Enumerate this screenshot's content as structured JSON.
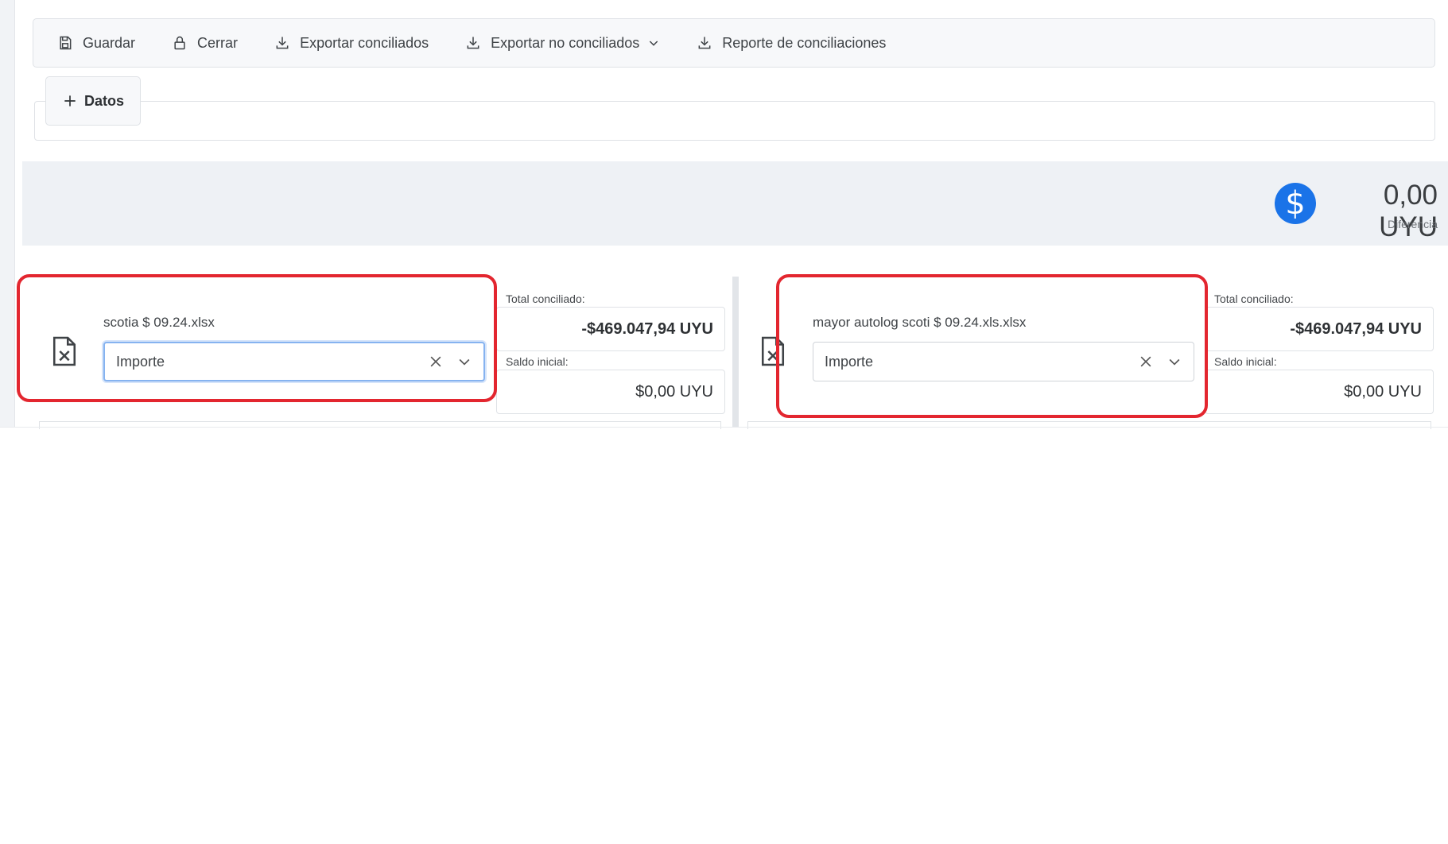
{
  "toolbar": {
    "buttons": [
      {
        "label": "Guardar",
        "icon": "save-icon"
      },
      {
        "label": "Cerrar",
        "icon": "lock-icon"
      },
      {
        "label": "Exportar conciliados",
        "icon": "download-icon"
      },
      {
        "label": "Exportar no conciliados",
        "icon": "download-icon",
        "dropdown": true
      },
      {
        "label": "Reporte de conciliaciones",
        "icon": "download-icon"
      }
    ]
  },
  "datos": {
    "label": "Datos",
    "icon": "plus-icon"
  },
  "summary": {
    "currency_symbol": "$",
    "amount": "0,00 UYU",
    "label": "Diferencia",
    "badge_color": "#1a73e8"
  },
  "left": {
    "file_name": "scotia $ 09.24.xlsx",
    "select_value": "Importe",
    "total_label": "Total conciliado:",
    "total_value": "-$469.047,94 UYU",
    "saldo_label": "Saldo inicial:",
    "saldo_value": "$0,00 UYU"
  },
  "right": {
    "file_name": "mayor autolog scoti $ 09.24.xls.xlsx",
    "select_value": "Importe",
    "total_label": "Total conciliado:",
    "total_value": "-$469.047,94 UYU",
    "saldo_label": "Saldo inicial:",
    "saldo_value": "$0,00 UYU"
  },
  "colors": {
    "highlight": "#e3262f",
    "accent": "#1a73e8"
  }
}
